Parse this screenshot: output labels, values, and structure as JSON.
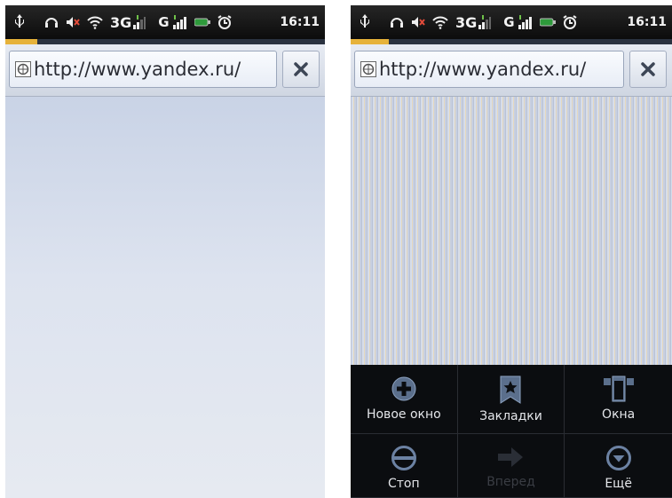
{
  "screens": [
    {
      "status_bar": {
        "network": "3G",
        "network2": "G",
        "time": "16:11",
        "icons": [
          "usb-icon",
          "headset-icon",
          "mute-icon",
          "wifi-icon",
          "signal-icon",
          "signal-icon",
          "battery-icon",
          "alarm-icon"
        ]
      },
      "page_load_progress": 0.1,
      "url_bar": {
        "url": "http://www.yandex.ru/",
        "close_icon": "close-icon"
      }
    },
    {
      "status_bar": {
        "network": "3G",
        "network2": "G",
        "time": "16:11",
        "icons": [
          "usb-icon",
          "headset-icon",
          "mute-icon",
          "wifi-icon",
          "signal-icon",
          "signal-icon",
          "battery-icon",
          "alarm-icon"
        ]
      },
      "page_load_progress": 0.12,
      "url_bar": {
        "url": "http://www.yandex.ru/",
        "close_icon": "close-icon"
      },
      "menu": {
        "items": [
          {
            "label": "Новое окно",
            "icon": "plus-circle-icon",
            "enabled": true
          },
          {
            "label": "Закладки",
            "icon": "bookmark-icon",
            "enabled": true
          },
          {
            "label": "Окна",
            "icon": "windows-icon",
            "enabled": true
          },
          {
            "label": "Стоп",
            "icon": "stop-icon",
            "enabled": true
          },
          {
            "label": "Вперед",
            "icon": "forward-arrow-icon",
            "enabled": false
          },
          {
            "label": "Ещё",
            "icon": "more-chevron-icon",
            "enabled": true
          }
        ]
      }
    }
  ],
  "colors": {
    "progress": "#e6b23a",
    "menu_bg": "#0b0d10"
  }
}
